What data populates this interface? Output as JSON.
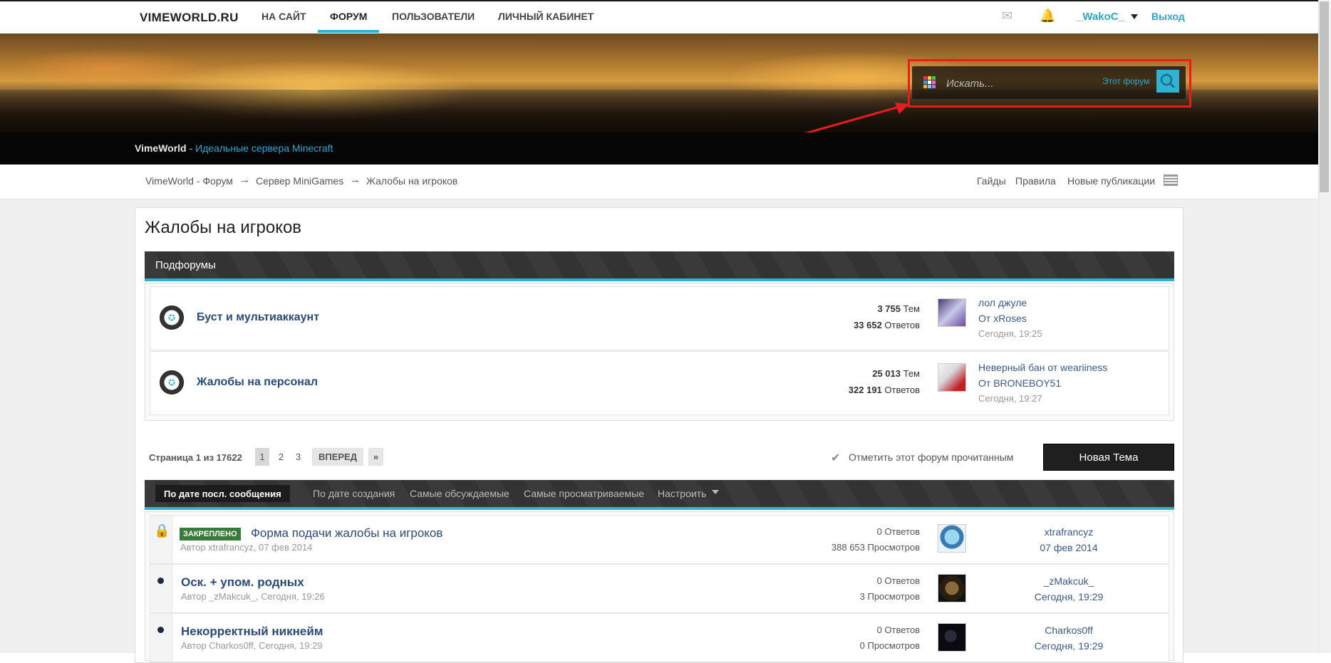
{
  "topnav": {
    "logo": "VIMEWORLD.RU",
    "items": [
      {
        "label": "НА САЙТ"
      },
      {
        "label": "ФОРУМ"
      },
      {
        "label": "ПОЛЬЗОВАТЕЛИ"
      },
      {
        "label": "ЛИЧНЫЙ КАБИНЕТ"
      }
    ],
    "username": "_WakoC_",
    "logout": "Выход"
  },
  "search": {
    "placeholder": "Искать...",
    "scope": "Этот форум"
  },
  "strip": {
    "brand": "VimeWorld",
    "separator": " - ",
    "tagline": "Идеальные сервера Minecraft"
  },
  "breadcrumb": {
    "items": [
      "VimeWorld - Форум",
      "Сервер MiniGames",
      "Жалобы на игроков"
    ],
    "arrow": "→"
  },
  "quicklinks": [
    "Гайды",
    "Правила",
    "Новые публикации"
  ],
  "page": {
    "title": "Жалобы на игроков"
  },
  "subforums": {
    "header": "Подфорумы",
    "items": [
      {
        "title": "Буст и мультиаккаунт",
        "topics_num": "3 755",
        "topics_label": "Тем",
        "replies_num": "33 652",
        "replies_label": "Ответов",
        "last_title": "лол джуле",
        "last_by": "От xRoses",
        "last_time": "Сегодня, 19:25"
      },
      {
        "title": "Жалобы на персонал",
        "topics_num": "25 013",
        "topics_label": "Тем",
        "replies_num": "322 191",
        "replies_label": "Ответов",
        "last_title": "Неверный бан от weariiness",
        "last_by": "От BRONEBOY51",
        "last_time": "Сегодня, 19:27"
      }
    ]
  },
  "pagination": {
    "info": "Страница 1 из 17622",
    "pages": [
      "1",
      "2",
      "3"
    ],
    "next": "ВПЕРЕД",
    "last": "»",
    "mark_read": "Отметить этот форум прочитанным",
    "new_topic": "Новая Тема"
  },
  "sort": {
    "active": "По дате посл. сообщения",
    "options": [
      "По дате создания",
      "Самые обсуждаемые",
      "Самые просматриваемые",
      "Настроить"
    ]
  },
  "threads": [
    {
      "pinned": "ЗАКРЕПЛЕНО",
      "title": "Форма подачи жалобы на игроков",
      "meta": "Автор xtrafrancyz, 07 фев 2014",
      "replies": "0 Ответов",
      "views": "388 653 Просмотров",
      "last_user": "xtrafrancyz",
      "last_time": "07 фев 2014"
    },
    {
      "title": "Оск. + упом. родных",
      "meta": "Автор _zMakcuk_, Сегодня, 19:26",
      "replies": "0 Ответов",
      "views": "3 Просмотров",
      "last_user": "_zMakcuk_",
      "last_time": "Сегодня, 19:29"
    },
    {
      "title": "Некорректный никнейм",
      "meta": "Автор Charkos0ff, Сегодня, 19:29",
      "replies": "0 Ответов",
      "views": "0 Просмотров",
      "last_user": "Charkos0ff",
      "last_time": "Сегодня, 19:29"
    }
  ],
  "colors": {
    "accent": "#2fb3d4",
    "annotation": "#e81c1c",
    "dark_bar": "#333333",
    "link": "#2a4a7a"
  },
  "icons": [
    "mail-icon",
    "bell-icon",
    "search-icon",
    "subforum-star-icon",
    "check-icon",
    "lock-icon",
    "layout-toggle-icon"
  ]
}
